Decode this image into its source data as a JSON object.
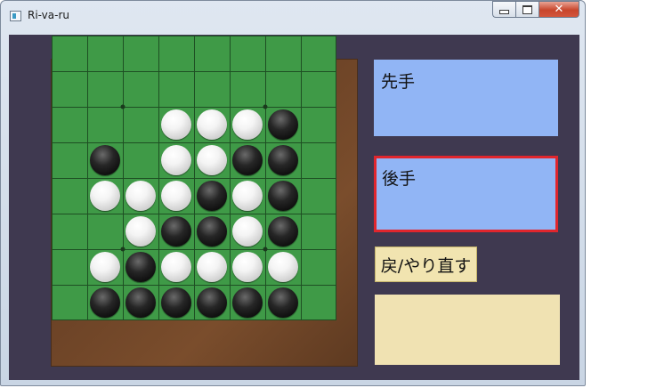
{
  "window": {
    "title": "Ri-va-ru"
  },
  "caption": {
    "minimize": "",
    "maximize": "",
    "close": "✕"
  },
  "side_panel": {
    "first_player_label": "先手",
    "second_player_label": "後手",
    "active_player": "second",
    "undo_redo_label": "戻/やり直す",
    "message": ""
  },
  "board": {
    "size": 8,
    "star_points": [
      [
        2,
        2
      ],
      [
        2,
        6
      ],
      [
        6,
        2
      ],
      [
        6,
        6
      ]
    ],
    "rows": [
      "........",
      "........",
      "...WWWB.",
      ".B.WWBB.",
      ".WWWBWB.",
      "..WBBWB.",
      ".WBWWWW.",
      ".BBBBBB."
    ],
    "colors": {
      "board_green": "#3f9a47",
      "grid_line": "#1e4f23",
      "frame_brown": "#6b4226"
    }
  }
}
